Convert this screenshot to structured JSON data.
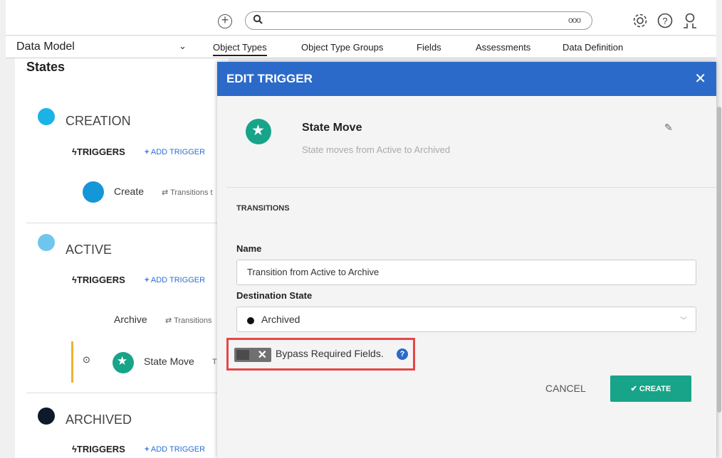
{
  "toolbar": {
    "add_icon": "plus-circle-icon",
    "search_icon": "search-icon",
    "more_label": "ooo",
    "settings_icon": "gear-icon",
    "help_icon": "question-circle-icon",
    "user_icon": "user-icon"
  },
  "nav": {
    "module": "Data Model",
    "module_chevron": "⌄",
    "tabs": [
      {
        "label": "Object Types",
        "active": true
      },
      {
        "label": "Object Type Groups"
      },
      {
        "label": "Fields"
      },
      {
        "label": "Assessments"
      },
      {
        "label": "Data Definition"
      }
    ]
  },
  "states_page": {
    "title": "States",
    "states": [
      {
        "name": "CREATION",
        "color": "#1ab3e8",
        "triggers_label": "TRIGGERS",
        "add_trigger": "ADD TRIGGER",
        "rows": [
          {
            "name": "Create",
            "transition": "Transitions t"
          }
        ]
      },
      {
        "name": "ACTIVE",
        "color": "#6ec6ee",
        "triggers_label": "TRIGGERS",
        "add_trigger": "ADD TRIGGER",
        "rows": [
          {
            "name": "Archive",
            "transition": "Transitions"
          },
          {
            "name": "State Move",
            "transition": "T"
          }
        ]
      },
      {
        "name": "ARCHIVED",
        "color": "#0c1a2a",
        "triggers_label": "TRIGGERS",
        "add_trigger": "ADD TRIGGER"
      }
    ]
  },
  "modal": {
    "title": "EDIT TRIGGER",
    "close": "✕",
    "trigger_name": "State Move",
    "trigger_description": "State moves from Active to Archived",
    "section_label": "TRANSITIONS",
    "name_label": "Name",
    "name_value": "Transition from Active to Archive",
    "destination_label": "Destination State",
    "destination_value": "Archived",
    "bypass_label": "Bypass Required Fields.",
    "bypass_enabled": false,
    "cancel_label": "CANCEL",
    "create_label": "CREATE",
    "accent": "#2b6ac9",
    "primary": "#17a488",
    "highlight": "#e64646"
  }
}
